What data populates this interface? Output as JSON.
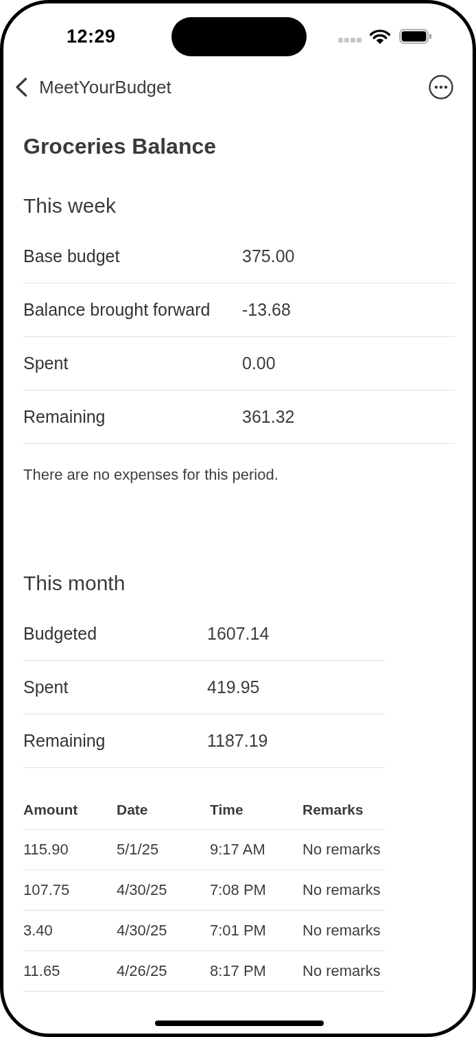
{
  "status_bar": {
    "time": "12:29"
  },
  "nav": {
    "back_label": "MeetYourBudget"
  },
  "title": "Groceries Balance",
  "sections": [
    {
      "heading": "This week",
      "rows": [
        {
          "label": "Base budget",
          "value": "375.00"
        },
        {
          "label": "Balance brought forward",
          "value": "-13.68"
        },
        {
          "label": "Spent",
          "value": "0.00"
        },
        {
          "label": "Remaining",
          "value": "361.32"
        }
      ],
      "note": "There are no expenses for this period."
    },
    {
      "heading": "This month",
      "rows": [
        {
          "label": "Budgeted",
          "value": "1607.14"
        },
        {
          "label": "Spent",
          "value": "419.95"
        },
        {
          "label": "Remaining",
          "value": "1187.19"
        }
      ],
      "table": {
        "columns": [
          "Amount",
          "Date",
          "Time",
          "Remarks"
        ],
        "rows": [
          [
            "115.90",
            "5/1/25",
            "9:17 AM",
            "No remarks"
          ],
          [
            "107.75",
            "4/30/25",
            "7:08 PM",
            "No remarks"
          ],
          [
            "3.40",
            "4/30/25",
            "7:01 PM",
            "No remarks"
          ],
          [
            "11.65",
            "4/26/25",
            "8:17 PM",
            "No remarks"
          ]
        ]
      }
    }
  ]
}
